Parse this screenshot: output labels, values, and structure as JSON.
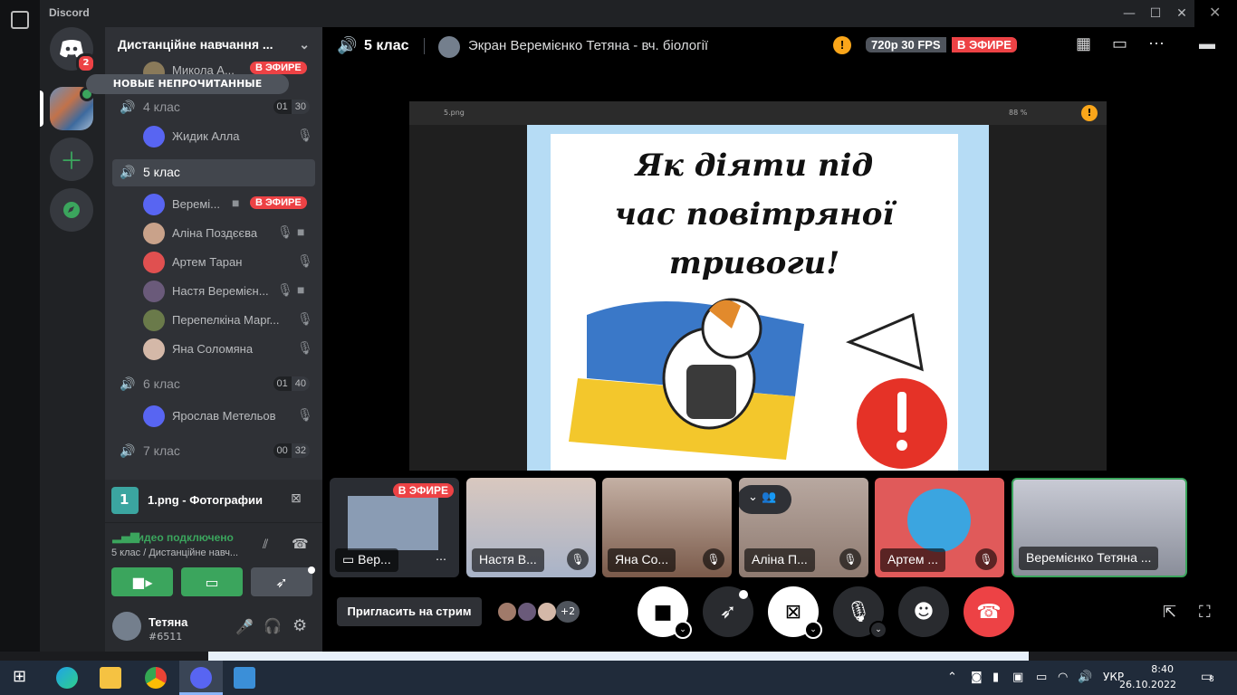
{
  "app": {
    "title": "Discord"
  },
  "guilds": {
    "home_badge": "2"
  },
  "server": {
    "name": "Дистанційне навчання ..."
  },
  "unread_pill": "НОВЫЕ НЕПРОЧИТАННЫЕ",
  "top_user": {
    "name": "Микола А...",
    "live": "В ЭФИРЕ"
  },
  "channels": [
    {
      "name": "4 клас",
      "count_a": "01",
      "count_b": "30"
    },
    {
      "name": "5 клас"
    },
    {
      "name": "6 клас",
      "count_a": "01",
      "count_b": "40"
    },
    {
      "name": "7 клас",
      "count_a": "00",
      "count_b": "32"
    }
  ],
  "users4": [
    {
      "name": "Жидик Алла"
    }
  ],
  "users5": [
    {
      "name": "Веремі...",
      "live": "В ЭФИРЕ"
    },
    {
      "name": "Аліна Поздєєва"
    },
    {
      "name": "Артем Таран"
    },
    {
      "name": "Настя Веремієн..."
    },
    {
      "name": "Перепелкіна Марг..."
    },
    {
      "name": "Яна Соломяна"
    }
  ],
  "users6": [
    {
      "name": "Ярослав Метельов"
    }
  ],
  "activity": {
    "icon_label": "1",
    "title": "1.png - Фотографии"
  },
  "voice": {
    "status": "Видео подключено",
    "detail": "5 клас / Дистанційне навч..."
  },
  "me": {
    "name": "Тетяна",
    "tag": "#6511"
  },
  "header": {
    "channel": "5 клас",
    "stream_title": "Экран Веремієнко Тетяна - вч. біології",
    "quality": "720p 30 FPS",
    "live": "В ЭФИРЕ"
  },
  "screen": {
    "file": "5.png",
    "zoom": "88 %"
  },
  "poster": {
    "line1": "Як діяти під",
    "line2": "час повітряної",
    "line3": "тривоги!"
  },
  "tiles": [
    {
      "name": "Вер...",
      "live": "В ЭФИРЕ"
    },
    {
      "name": "Настя В..."
    },
    {
      "name": "Яна Со..."
    },
    {
      "name": "Аліна П..."
    },
    {
      "name": "Артем ..."
    },
    {
      "name": "Веремієнко Тетяна ..."
    }
  ],
  "controls": {
    "invite": "Пригласить на стрим",
    "more_count": "+2"
  },
  "taskbar": {
    "lang": "УКР",
    "time": "8:40",
    "date": "26.10.2022",
    "notif": "8"
  }
}
